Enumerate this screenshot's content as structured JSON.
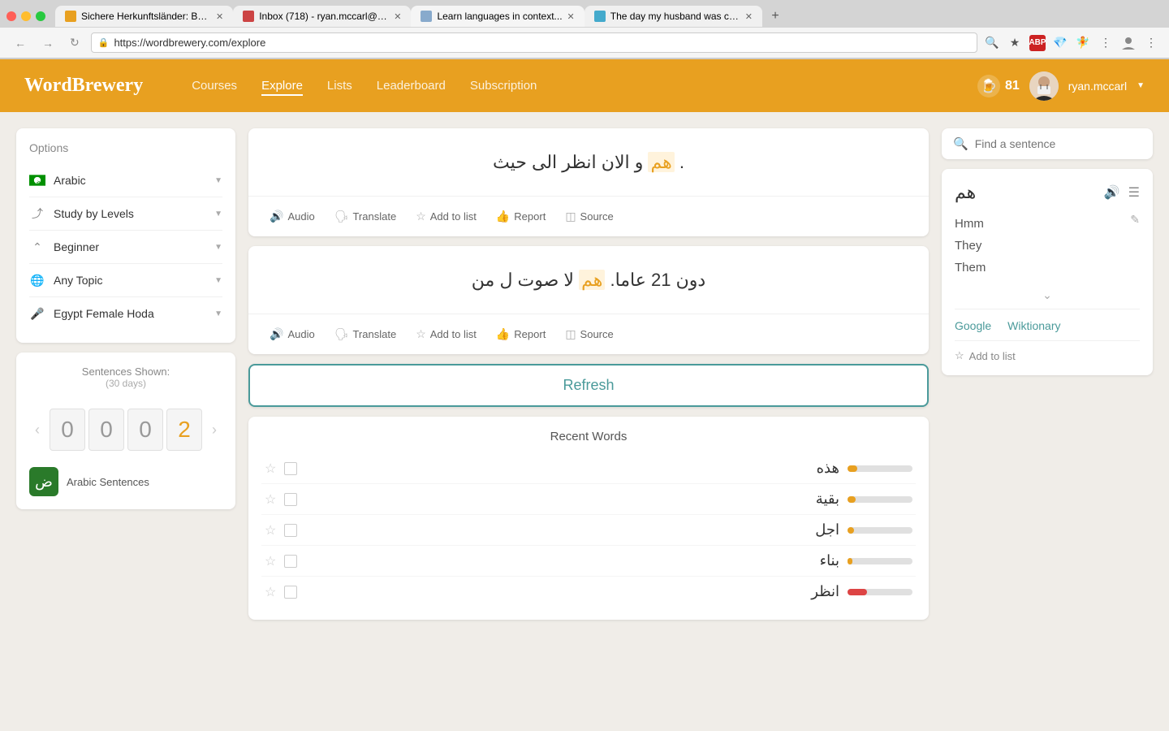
{
  "browser": {
    "tabs": [
      {
        "id": 1,
        "favicon_color": "#e8a020",
        "label": "Sichere Herkunftsländer: Bun...",
        "active": false
      },
      {
        "id": 2,
        "favicon_color": "#cc4444",
        "label": "Inbox (718) - ryan.mccarl@gm...",
        "active": false
      },
      {
        "id": 3,
        "favicon_color": "#88aacc",
        "label": "Learn languages in context...",
        "active": true
      },
      {
        "id": 4,
        "favicon_color": "#44aacc",
        "label": "The day my husband was cau...",
        "active": false
      }
    ],
    "address": "https://wordbrewery.com/explore"
  },
  "header": {
    "logo": "WordBrewery",
    "nav": [
      "Courses",
      "Explore",
      "Lists",
      "Leaderboard",
      "Subscription"
    ],
    "active_nav": "Explore",
    "xp": "81",
    "username": "ryan.mccarl"
  },
  "sidebar": {
    "options_title": "Options",
    "options": [
      {
        "label": "Arabic",
        "type": "flag"
      },
      {
        "label": "Study by Levels",
        "type": "trend"
      },
      {
        "label": "Beginner",
        "type": "chevron-up"
      },
      {
        "label": "Any Topic",
        "type": "globe"
      },
      {
        "label": "Egypt Female Hoda",
        "type": "mic"
      }
    ],
    "stats": {
      "title": "Sentences Shown:",
      "subtitle": "(30 days)",
      "digits": [
        "0",
        "0",
        "0",
        "2"
      ],
      "highlight_index": 3
    },
    "course": {
      "label": "Arabic Sentences",
      "icon": "ض"
    }
  },
  "sentences": [
    {
      "text_before": "و الان انظر الى حيث",
      "highlight": "هم",
      "text_after": ".",
      "actions": [
        "Audio",
        "Translate",
        "Add to list",
        "Report",
        "Source"
      ]
    },
    {
      "text_before": "لا صوت ل من",
      "highlight": "هم",
      "text_after": "دون 21 عاما.",
      "actions": [
        "Audio",
        "Translate",
        "Add to list",
        "Report",
        "Source"
      ]
    }
  ],
  "refresh_btn": "Refresh",
  "recent_words": {
    "title": "Recent Words",
    "words": [
      {
        "arabic": "هذه",
        "bar": 15,
        "red": false
      },
      {
        "arabic": "بقية",
        "bar": 12,
        "red": false
      },
      {
        "arabic": "اجل",
        "bar": 10,
        "red": false
      },
      {
        "arabic": "بناء",
        "bar": 8,
        "red": false
      },
      {
        "arabic": "انظر",
        "bar": 30,
        "red": true
      }
    ]
  },
  "right_panel": {
    "search_placeholder": "Find a sentence",
    "word": {
      "arabic": "هم",
      "meanings": [
        "Hmm",
        "They",
        "Them"
      ],
      "google_label": "Google",
      "wiktionary_label": "Wiktionary",
      "add_to_list_label": "Add to list"
    }
  }
}
